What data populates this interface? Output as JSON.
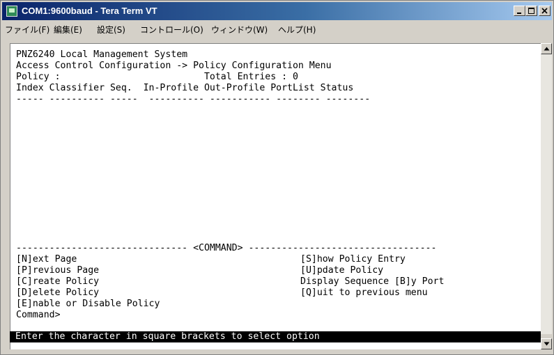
{
  "window": {
    "title": "COM1:9600baud - Tera Term VT"
  },
  "menu": [
    "ファイル(F)",
    "編集(E)",
    "設定(S)",
    "コントロール(O)",
    "ウィンドウ(W)",
    "ヘルプ(H)"
  ],
  "terminal": {
    "lines": [
      "PNZ6240 Local Management System",
      "Access Control Configuration -> Policy Configuration Menu",
      "Policy :                          Total Entries : 0",
      "Index Classifier Seq.  In-Profile Out-Profile PortList Status",
      "----- ---------- -----  ---------- ----------- -------- --------"
    ],
    "command_divider": "------------------------------- <COMMAND> ----------------------------------",
    "commands_left": [
      "[N]ext Page",
      "[P]revious Page",
      "[C]reate Policy",
      "[D]elete Policy",
      "[E]nable or Disable Policy"
    ],
    "commands_right": [
      "[S]how Policy Entry",
      "[U]pdate Policy",
      "Display Sequence [B]y Port",
      "[Q]uit to previous menu"
    ],
    "prompt": "Command>",
    "status_message": "Enter the character in square brackets to select option"
  }
}
